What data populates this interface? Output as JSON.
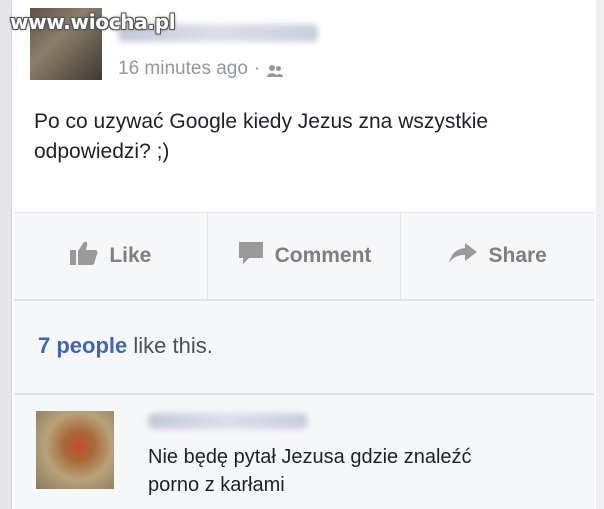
{
  "watermark": "www.wiocha.pl",
  "post": {
    "timestamp": "16 minutes ago",
    "separator": "·",
    "audience_icon": "friends-icon",
    "text": "Po co uzywać Google kiedy Jezus zna wszystkie odpowiedzi? ;)"
  },
  "actions": {
    "like_label": "Like",
    "comment_label": "Comment",
    "share_label": "Share"
  },
  "likes": {
    "count_label": "7 people",
    "suffix": "like this."
  },
  "comment": {
    "text_line1": "Nie będę pytał Jezusa gdzie znaleźć",
    "text_line2": "porno z karłami"
  },
  "colors": {
    "link": "#4267b2",
    "action_text": "#7f7f7f",
    "meta_text": "#9197a3",
    "panel_bg": "#f6f7f9"
  }
}
